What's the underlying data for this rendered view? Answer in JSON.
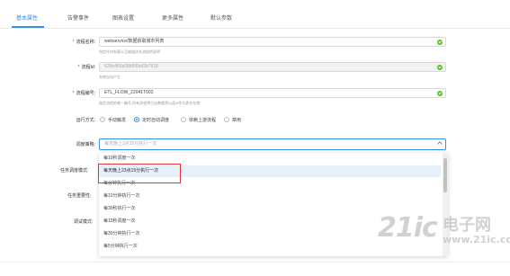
{
  "tabs": [
    {
      "label": "基本属性",
      "active": true
    },
    {
      "label": "告警事件",
      "active": false
    },
    {
      "label": "图表设置",
      "active": false
    },
    {
      "label": "更多属性",
      "active": false
    },
    {
      "label": "默认参数",
      "active": false
    }
  ],
  "form": {
    "flow_name": {
      "label": "流程名称:",
      "value": "webservice/数据获取城市列表",
      "hint": "指定任何有意义且能描述本流程的说明"
    },
    "flow_id": {
      "label": "流程Id:",
      "value": "629e465a08bf56bd2b7518",
      "hint": "系统自动产生"
    },
    "flow_code": {
      "label": "流程编号:",
      "value": "ETL_FLOW_22041T002",
      "hint": "指定流程的唯一编号,所有流程将日志数据将以此id作为表名存储"
    },
    "run_mode": {
      "label": "运行方式:",
      "options": [
        "手动触发",
        "定时自动调度",
        "依赖上游流程",
        "禁用"
      ],
      "selected_index": 1
    },
    "schedule": {
      "label": "调度策略:",
      "placeholder": "每天晚上2点15分执行一次"
    },
    "side_labels": [
      "任务调度模式:",
      "任务重要性:",
      "调试模式:"
    ]
  },
  "dropdown": {
    "options": [
      "每10秒调度一次",
      "每天晚上23点15分执行一次",
      "每分钟执行一次",
      "每10分钟执行一次",
      "每30秒执行一次",
      "每15秒调度一次",
      "每30分钟执行一次",
      "每5分钟执行一次"
    ],
    "highlighted_index": 1
  },
  "watermark": {
    "main": "21ic",
    "cn": "电子网",
    "url": "www.21ic.com"
  },
  "colors": {
    "accent": "#3a8ee6",
    "success": "#52c41a",
    "required": "#e33",
    "annotation": "#e23636"
  }
}
